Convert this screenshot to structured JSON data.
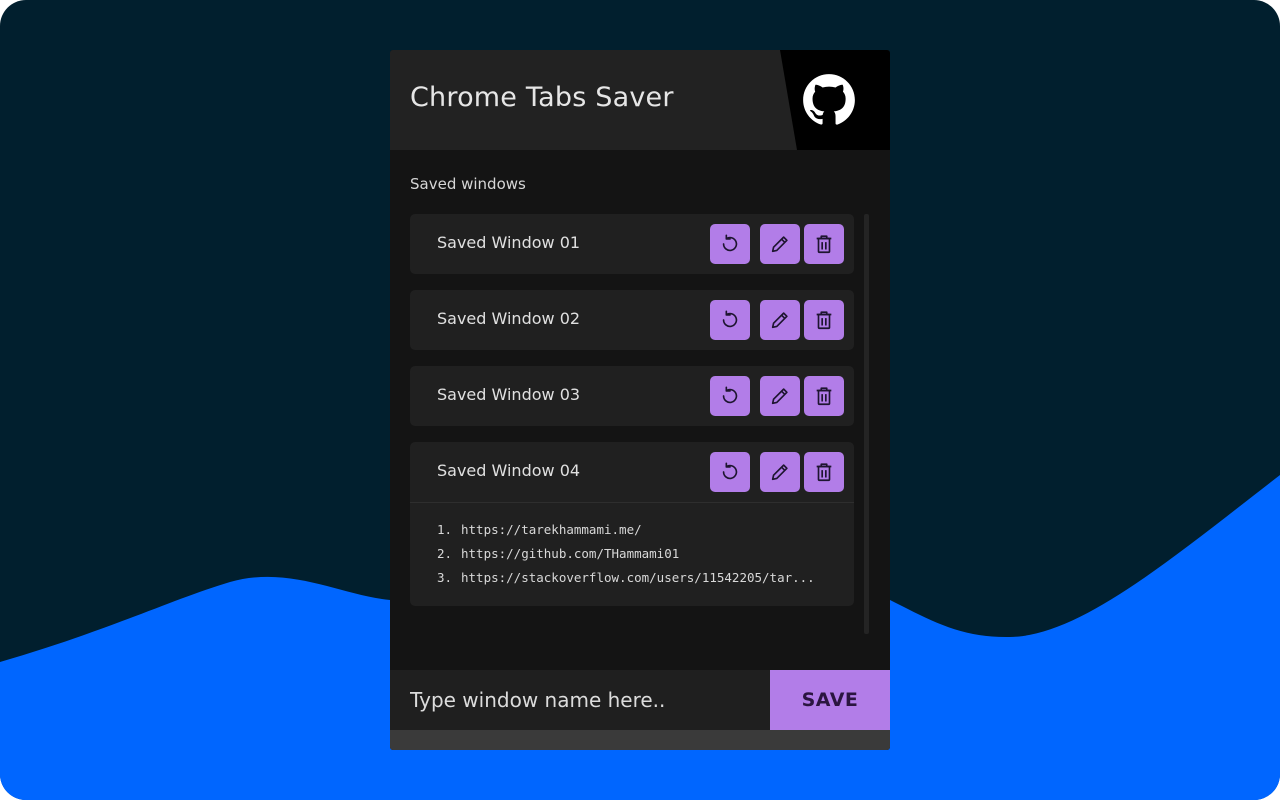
{
  "colors": {
    "background": "#011f2e",
    "wave": "#0066ff",
    "accent": "#b27de8",
    "panel": "#141414",
    "card": "#202020"
  },
  "header": {
    "title": "Chrome Tabs Saver",
    "github_icon": "github-icon"
  },
  "section_label": "Saved windows",
  "icons": {
    "restore": "restore-icon",
    "edit": "pencil-icon",
    "delete": "trash-icon"
  },
  "windows": [
    {
      "name": "Saved Window 01"
    },
    {
      "name": "Saved Window 02"
    },
    {
      "name": "Saved Window 03"
    },
    {
      "name": "Saved Window 04",
      "expanded": true,
      "tabs": [
        {
          "num": "1.",
          "url": "https://tarekhammami.me/"
        },
        {
          "num": "2.",
          "url": "https://github.com/THammami01"
        },
        {
          "num": "3.",
          "url": "https://stackoverflow.com/users/11542205/tar..."
        }
      ]
    }
  ],
  "footer": {
    "input_placeholder": "Type window name here..",
    "input_value": "",
    "save_label": "SAVE"
  }
}
